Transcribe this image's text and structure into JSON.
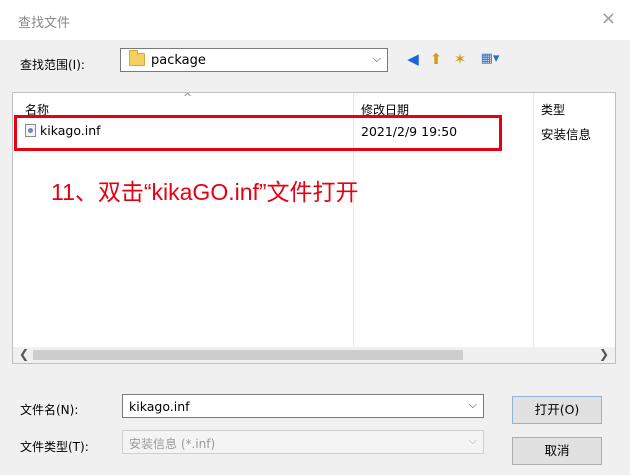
{
  "window": {
    "title": "查找文件",
    "close_glyph": "×"
  },
  "look_in": {
    "label": "查找范围(I):",
    "value": "package"
  },
  "columns": {
    "name": "名称",
    "modified": "修改日期",
    "type": "类型"
  },
  "file": {
    "name": "kikago.inf",
    "modified": "2021/2/9 19:50",
    "type": "安装信息"
  },
  "annotation": "11、双击“kikaGO.inf”文件打开",
  "filename": {
    "label": "文件名(N):",
    "value": "kikago.inf"
  },
  "filetype": {
    "label": "文件类型(T):",
    "value": "安装信息 (*.inf)"
  },
  "buttons": {
    "open": "打开(O)",
    "cancel": "取消"
  },
  "colors": {
    "highlight": "#e60012"
  }
}
